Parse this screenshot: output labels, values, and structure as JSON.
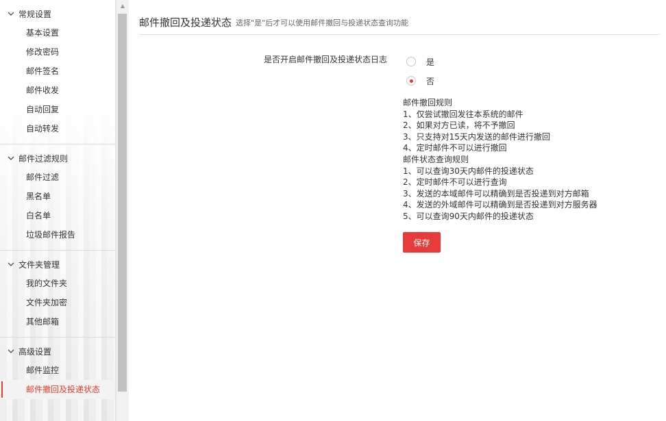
{
  "sidebar": {
    "groups": [
      {
        "title": "常规设置",
        "items": [
          "基本设置",
          "修改密码",
          "邮件签名",
          "邮件收发",
          "自动回复",
          "自动转发"
        ]
      },
      {
        "title": "邮件过滤规则",
        "items": [
          "邮件过滤",
          "黑名单",
          "白名单",
          "垃圾邮件报告"
        ]
      },
      {
        "title": "文件夹管理",
        "items": [
          "我的文件夹",
          "文件夹加密",
          "其他邮箱"
        ]
      },
      {
        "title": "高级设置",
        "items": [
          "邮件监控",
          "邮件撤回及投递状态"
        ]
      }
    ],
    "active_item": "邮件撤回及投递状态"
  },
  "header": {
    "title": "邮件撤回及投递状态",
    "subtitle": "选择\"是\"后才可以使用邮件撤回与投递状态查询功能"
  },
  "form": {
    "label": "是否开启邮件撤回及投递状态日志",
    "options": [
      {
        "label": "是",
        "selected": false
      },
      {
        "label": "否",
        "selected": true
      }
    ]
  },
  "rules": {
    "lines": [
      "邮件撤回规则",
      "1、仅尝试撤回发往本系统的邮件",
      "2、如果对方已读，将不予撤回",
      "3、只支持对15天内发送的邮件进行撤回",
      "4、定时邮件不可以进行撤回",
      "邮件状态查询规则",
      "1、可以查询30天内邮件的投递状态",
      "2、定时邮件不可以进行查询",
      "3、发送的本域邮件可以精确到是否投递到对方邮箱",
      "4、发送的外域邮件可以精确到是否投递到对方服务器",
      "5、可以查询90天内邮件的投递状态"
    ]
  },
  "buttons": {
    "save": "保存"
  },
  "colors": {
    "accent": "#e73b3b",
    "active_text": "#e23d2e"
  }
}
